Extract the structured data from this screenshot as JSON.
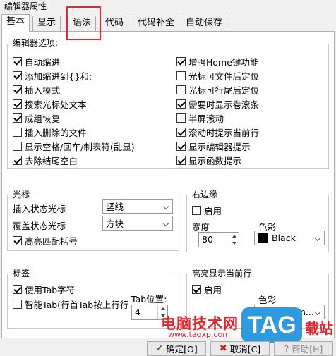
{
  "window": {
    "title": "编辑器属性"
  },
  "tabs": [
    {
      "label": "基本",
      "active": true
    },
    {
      "label": "显示",
      "active": false
    },
    {
      "label": "语法",
      "active": false
    },
    {
      "label": "代码",
      "active": false
    },
    {
      "label": "代码补全",
      "active": false
    },
    {
      "label": "自动保存",
      "active": false
    }
  ],
  "editor_options": {
    "title": "编辑器选项:",
    "left": [
      {
        "label": "自动缩进",
        "checked": true
      },
      {
        "label": "添加缩进到{}和:",
        "checked": true
      },
      {
        "label": "插入模式",
        "checked": true
      },
      {
        "label": "搜索光标处文本",
        "checked": true
      },
      {
        "label": "成组恢复",
        "checked": true
      },
      {
        "label": "插入删除的文件",
        "checked": false
      },
      {
        "label": "显示空格/回车/制表符(乱显)",
        "checked": false
      },
      {
        "label": "去除结尾空白",
        "checked": true
      }
    ],
    "right": [
      {
        "label": "增强Home键功能",
        "checked": true
      },
      {
        "label": "光标可文件后定位",
        "checked": false
      },
      {
        "label": "光标可行尾后定位",
        "checked": false
      },
      {
        "label": "需要时显示卷滚条",
        "checked": true
      },
      {
        "label": "半屏滚动",
        "checked": false
      },
      {
        "label": "滚动时提示当前行",
        "checked": true
      },
      {
        "label": "显示编辑器提示",
        "checked": true
      },
      {
        "label": "显示函数提示",
        "checked": true
      }
    ]
  },
  "cursor": {
    "title": "光标",
    "insert_label": "插入状态光标",
    "insert_value": "竖线",
    "overwrite_label": "覆盖状态光标",
    "overwrite_value": "方块",
    "match_brackets": {
      "label": "高亮匹配括号",
      "checked": true
    }
  },
  "right_margin": {
    "title": "右边缘",
    "enable": {
      "label": "启用",
      "checked": false
    },
    "width_label": "宽度",
    "width_value": "80",
    "color_label": "色彩",
    "color_value": "Black",
    "color_hex": "#000000"
  },
  "tabs_group": {
    "title": "标签",
    "use_tab": {
      "label": "使用Tab字符",
      "checked": true
    },
    "smart_tab": {
      "label": "智能Tab(行首Tab按上行行",
      "checked": false
    },
    "tab_pos_label": "Tab位置:",
    "tab_pos_value": "4"
  },
  "highlight_line": {
    "title": "高亮显示当前行",
    "enable": {
      "label": "启用",
      "checked": true
    },
    "color_label": "色彩",
    "color_value": "Custom..."
  },
  "buttons": {
    "ok": "确定[O]",
    "cancel": "取消[C]",
    "help": "帮助[H]"
  },
  "watermark": {
    "text": "电脑技术网",
    "url": "www.tagxp.com",
    "logo": "TAG",
    "site": "载站"
  }
}
